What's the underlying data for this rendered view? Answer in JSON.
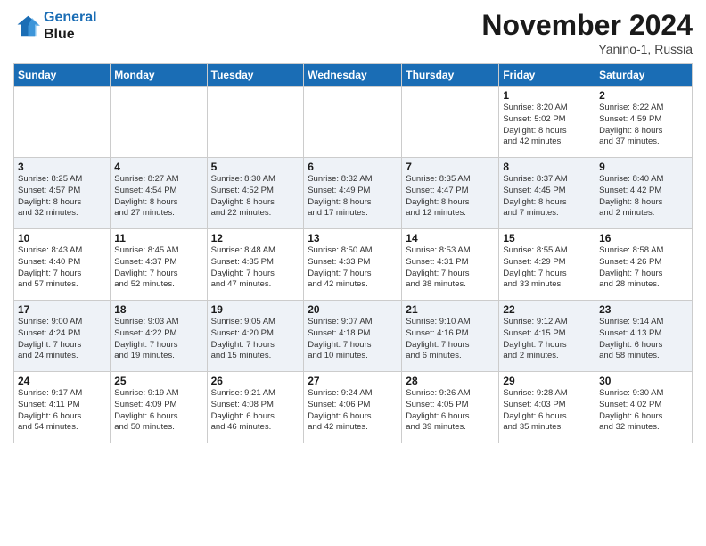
{
  "header": {
    "logo_line1": "General",
    "logo_line2": "Blue",
    "month_title": "November 2024",
    "location": "Yanino-1, Russia"
  },
  "days_of_week": [
    "Sunday",
    "Monday",
    "Tuesday",
    "Wednesday",
    "Thursday",
    "Friday",
    "Saturday"
  ],
  "weeks": [
    {
      "days": [
        {
          "num": "",
          "info": ""
        },
        {
          "num": "",
          "info": ""
        },
        {
          "num": "",
          "info": ""
        },
        {
          "num": "",
          "info": ""
        },
        {
          "num": "",
          "info": ""
        },
        {
          "num": "1",
          "info": "Sunrise: 8:20 AM\nSunset: 5:02 PM\nDaylight: 8 hours\nand 42 minutes."
        },
        {
          "num": "2",
          "info": "Sunrise: 8:22 AM\nSunset: 4:59 PM\nDaylight: 8 hours\nand 37 minutes."
        }
      ]
    },
    {
      "days": [
        {
          "num": "3",
          "info": "Sunrise: 8:25 AM\nSunset: 4:57 PM\nDaylight: 8 hours\nand 32 minutes."
        },
        {
          "num": "4",
          "info": "Sunrise: 8:27 AM\nSunset: 4:54 PM\nDaylight: 8 hours\nand 27 minutes."
        },
        {
          "num": "5",
          "info": "Sunrise: 8:30 AM\nSunset: 4:52 PM\nDaylight: 8 hours\nand 22 minutes."
        },
        {
          "num": "6",
          "info": "Sunrise: 8:32 AM\nSunset: 4:49 PM\nDaylight: 8 hours\nand 17 minutes."
        },
        {
          "num": "7",
          "info": "Sunrise: 8:35 AM\nSunset: 4:47 PM\nDaylight: 8 hours\nand 12 minutes."
        },
        {
          "num": "8",
          "info": "Sunrise: 8:37 AM\nSunset: 4:45 PM\nDaylight: 8 hours\nand 7 minutes."
        },
        {
          "num": "9",
          "info": "Sunrise: 8:40 AM\nSunset: 4:42 PM\nDaylight: 8 hours\nand 2 minutes."
        }
      ]
    },
    {
      "days": [
        {
          "num": "10",
          "info": "Sunrise: 8:43 AM\nSunset: 4:40 PM\nDaylight: 7 hours\nand 57 minutes."
        },
        {
          "num": "11",
          "info": "Sunrise: 8:45 AM\nSunset: 4:37 PM\nDaylight: 7 hours\nand 52 minutes."
        },
        {
          "num": "12",
          "info": "Sunrise: 8:48 AM\nSunset: 4:35 PM\nDaylight: 7 hours\nand 47 minutes."
        },
        {
          "num": "13",
          "info": "Sunrise: 8:50 AM\nSunset: 4:33 PM\nDaylight: 7 hours\nand 42 minutes."
        },
        {
          "num": "14",
          "info": "Sunrise: 8:53 AM\nSunset: 4:31 PM\nDaylight: 7 hours\nand 38 minutes."
        },
        {
          "num": "15",
          "info": "Sunrise: 8:55 AM\nSunset: 4:29 PM\nDaylight: 7 hours\nand 33 minutes."
        },
        {
          "num": "16",
          "info": "Sunrise: 8:58 AM\nSunset: 4:26 PM\nDaylight: 7 hours\nand 28 minutes."
        }
      ]
    },
    {
      "days": [
        {
          "num": "17",
          "info": "Sunrise: 9:00 AM\nSunset: 4:24 PM\nDaylight: 7 hours\nand 24 minutes."
        },
        {
          "num": "18",
          "info": "Sunrise: 9:03 AM\nSunset: 4:22 PM\nDaylight: 7 hours\nand 19 minutes."
        },
        {
          "num": "19",
          "info": "Sunrise: 9:05 AM\nSunset: 4:20 PM\nDaylight: 7 hours\nand 15 minutes."
        },
        {
          "num": "20",
          "info": "Sunrise: 9:07 AM\nSunset: 4:18 PM\nDaylight: 7 hours\nand 10 minutes."
        },
        {
          "num": "21",
          "info": "Sunrise: 9:10 AM\nSunset: 4:16 PM\nDaylight: 7 hours\nand 6 minutes."
        },
        {
          "num": "22",
          "info": "Sunrise: 9:12 AM\nSunset: 4:15 PM\nDaylight: 7 hours\nand 2 minutes."
        },
        {
          "num": "23",
          "info": "Sunrise: 9:14 AM\nSunset: 4:13 PM\nDaylight: 6 hours\nand 58 minutes."
        }
      ]
    },
    {
      "days": [
        {
          "num": "24",
          "info": "Sunrise: 9:17 AM\nSunset: 4:11 PM\nDaylight: 6 hours\nand 54 minutes."
        },
        {
          "num": "25",
          "info": "Sunrise: 9:19 AM\nSunset: 4:09 PM\nDaylight: 6 hours\nand 50 minutes."
        },
        {
          "num": "26",
          "info": "Sunrise: 9:21 AM\nSunset: 4:08 PM\nDaylight: 6 hours\nand 46 minutes."
        },
        {
          "num": "27",
          "info": "Sunrise: 9:24 AM\nSunset: 4:06 PM\nDaylight: 6 hours\nand 42 minutes."
        },
        {
          "num": "28",
          "info": "Sunrise: 9:26 AM\nSunset: 4:05 PM\nDaylight: 6 hours\nand 39 minutes."
        },
        {
          "num": "29",
          "info": "Sunrise: 9:28 AM\nSunset: 4:03 PM\nDaylight: 6 hours\nand 35 minutes."
        },
        {
          "num": "30",
          "info": "Sunrise: 9:30 AM\nSunset: 4:02 PM\nDaylight: 6 hours\nand 32 minutes."
        }
      ]
    }
  ]
}
